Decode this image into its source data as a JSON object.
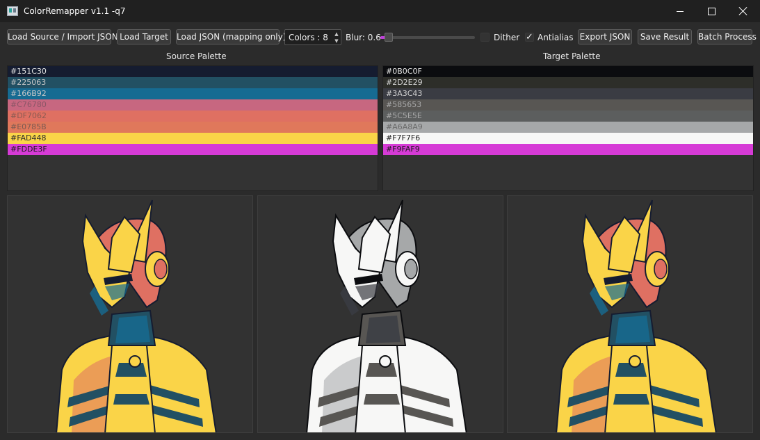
{
  "window": {
    "title": "ColorRemapper v1.1 -q7"
  },
  "toolbar": {
    "load_source": "Load Source / Import JSON",
    "load_target": "Load Target",
    "load_json": "Load JSON (mapping only)",
    "colors_value": "Colors : 8",
    "blur_label": "Blur: 0.6",
    "blur_fraction": 0.06,
    "dither_label": "Dither",
    "dither_checked": false,
    "antialias_label": "Antialias",
    "antialias_checked": true,
    "export_json": "Export JSON",
    "save_result": "Save Result",
    "batch_process": "Batch Process"
  },
  "source_palette": {
    "header": "Source Palette",
    "colors": [
      {
        "label": "#151C30",
        "hex": "#151C30",
        "text": "#e6e6e6"
      },
      {
        "label": "#225063",
        "hex": "#225063",
        "text": "#c8c8c8"
      },
      {
        "label": "#166B92",
        "hex": "#166B92",
        "text": "#c8c8c8"
      },
      {
        "label": "#C76780",
        "hex": "#C76780",
        "text": "#8a5566"
      },
      {
        "label": "#DF7062",
        "hex": "#DF7062",
        "text": "#8a5a52"
      },
      {
        "label": "#E0785B",
        "hex": "#E0785B",
        "text": "#7a5a52"
      },
      {
        "label": "#FAD448",
        "hex": "#FAD448",
        "text": "#2a2a2a"
      },
      {
        "label": "#FDDE3F",
        "hex": "#D63BD6",
        "text": "#1a1a1a"
      }
    ]
  },
  "target_palette": {
    "header": "Target Palette",
    "colors": [
      {
        "label": "#0B0C0F",
        "hex": "#0B0C0F",
        "text": "#e6e6e6"
      },
      {
        "label": "#2D2E29",
        "hex": "#2D2E29",
        "text": "#d6d6d6"
      },
      {
        "label": "#3A3C43",
        "hex": "#3A3C43",
        "text": "#d6d6d6"
      },
      {
        "label": "#585653",
        "hex": "#585653",
        "text": "#a8a8a8"
      },
      {
        "label": "#5C5E5E",
        "hex": "#5C5E5E",
        "text": "#a8a8a8"
      },
      {
        "label": "#A6A8A9",
        "hex": "#A6A8A9",
        "text": "#6a6a6a"
      },
      {
        "label": "#F7F7F6",
        "hex": "#F7F7F6",
        "text": "#222222"
      },
      {
        "label": "#F9FAF9",
        "hex": "#D63BD6",
        "text": "#1a1a1a"
      }
    ]
  },
  "panels": {
    "source": {
      "primary": "#FAD448",
      "accent": "#DF7062",
      "shade": "#225063",
      "dark": "#151C30",
      "visor": "#166B92"
    },
    "target": {
      "primary": "#F7F7F6",
      "accent": "#A6A8A9",
      "shade": "#585653",
      "dark": "#0B0C0F",
      "visor": "#3A3C43"
    },
    "result": {
      "primary": "#FAD448",
      "accent": "#DF7062",
      "shade": "#225063",
      "dark": "#151C30",
      "visor": "#166B92"
    }
  },
  "colors": {
    "accent": "#C040D8",
    "background": "#2B2B2B"
  },
  "icons": {
    "app": "app-icon",
    "minimize": "minimize-icon",
    "maximize": "maximize-icon",
    "close": "close-icon"
  }
}
